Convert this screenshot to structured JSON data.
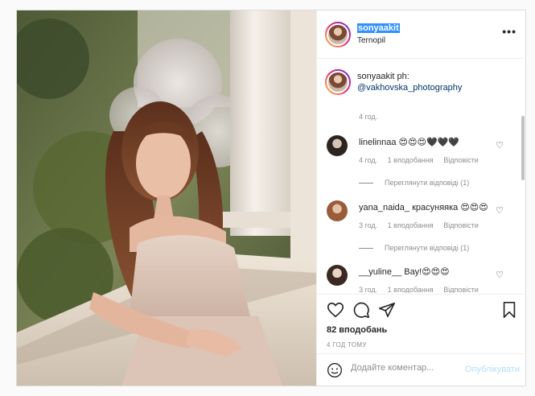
{
  "header": {
    "username": "sonyaakit",
    "location": "Ternopil",
    "more_icon": "more-horizontal-icon"
  },
  "caption": {
    "username": "sonyaakit",
    "text": "ph:",
    "mention": "@vakhovska_photography",
    "time": "4 год."
  },
  "comments": [
    {
      "username": "linelinnaa",
      "text": "😍😍😍🖤🖤🖤",
      "time": "4 год.",
      "likes": "1 вподобання",
      "reply": "Відповісти",
      "view_replies": "Переглянути відповіді (1)"
    },
    {
      "username": "yana_naida_",
      "text": "красуняяка 😍😍😍",
      "time": "3 год.",
      "likes": "1 вподобання",
      "reply": "Відповісти",
      "view_replies": "Переглянути відповіді (1)"
    },
    {
      "username": "__yuline__",
      "text": "Вау!😍😍😍",
      "time": "3 год.",
      "likes": "1 вподобання",
      "reply": "Відповісти",
      "view_replies": ""
    }
  ],
  "actions": {
    "like_icon": "heart-icon",
    "comment_icon": "comment-icon",
    "share_icon": "send-icon",
    "save_icon": "bookmark-icon",
    "likes": "82 вподобань",
    "timeago": "4 ГОД ТОМУ"
  },
  "add_comment": {
    "placeholder": "Додайте коментар...",
    "publish": "Опублікувати"
  },
  "colors": {
    "link": "#00376b",
    "publish_disabled": "#b2dffc",
    "selection": "#3390ff",
    "muted": "#8e8e8e"
  }
}
